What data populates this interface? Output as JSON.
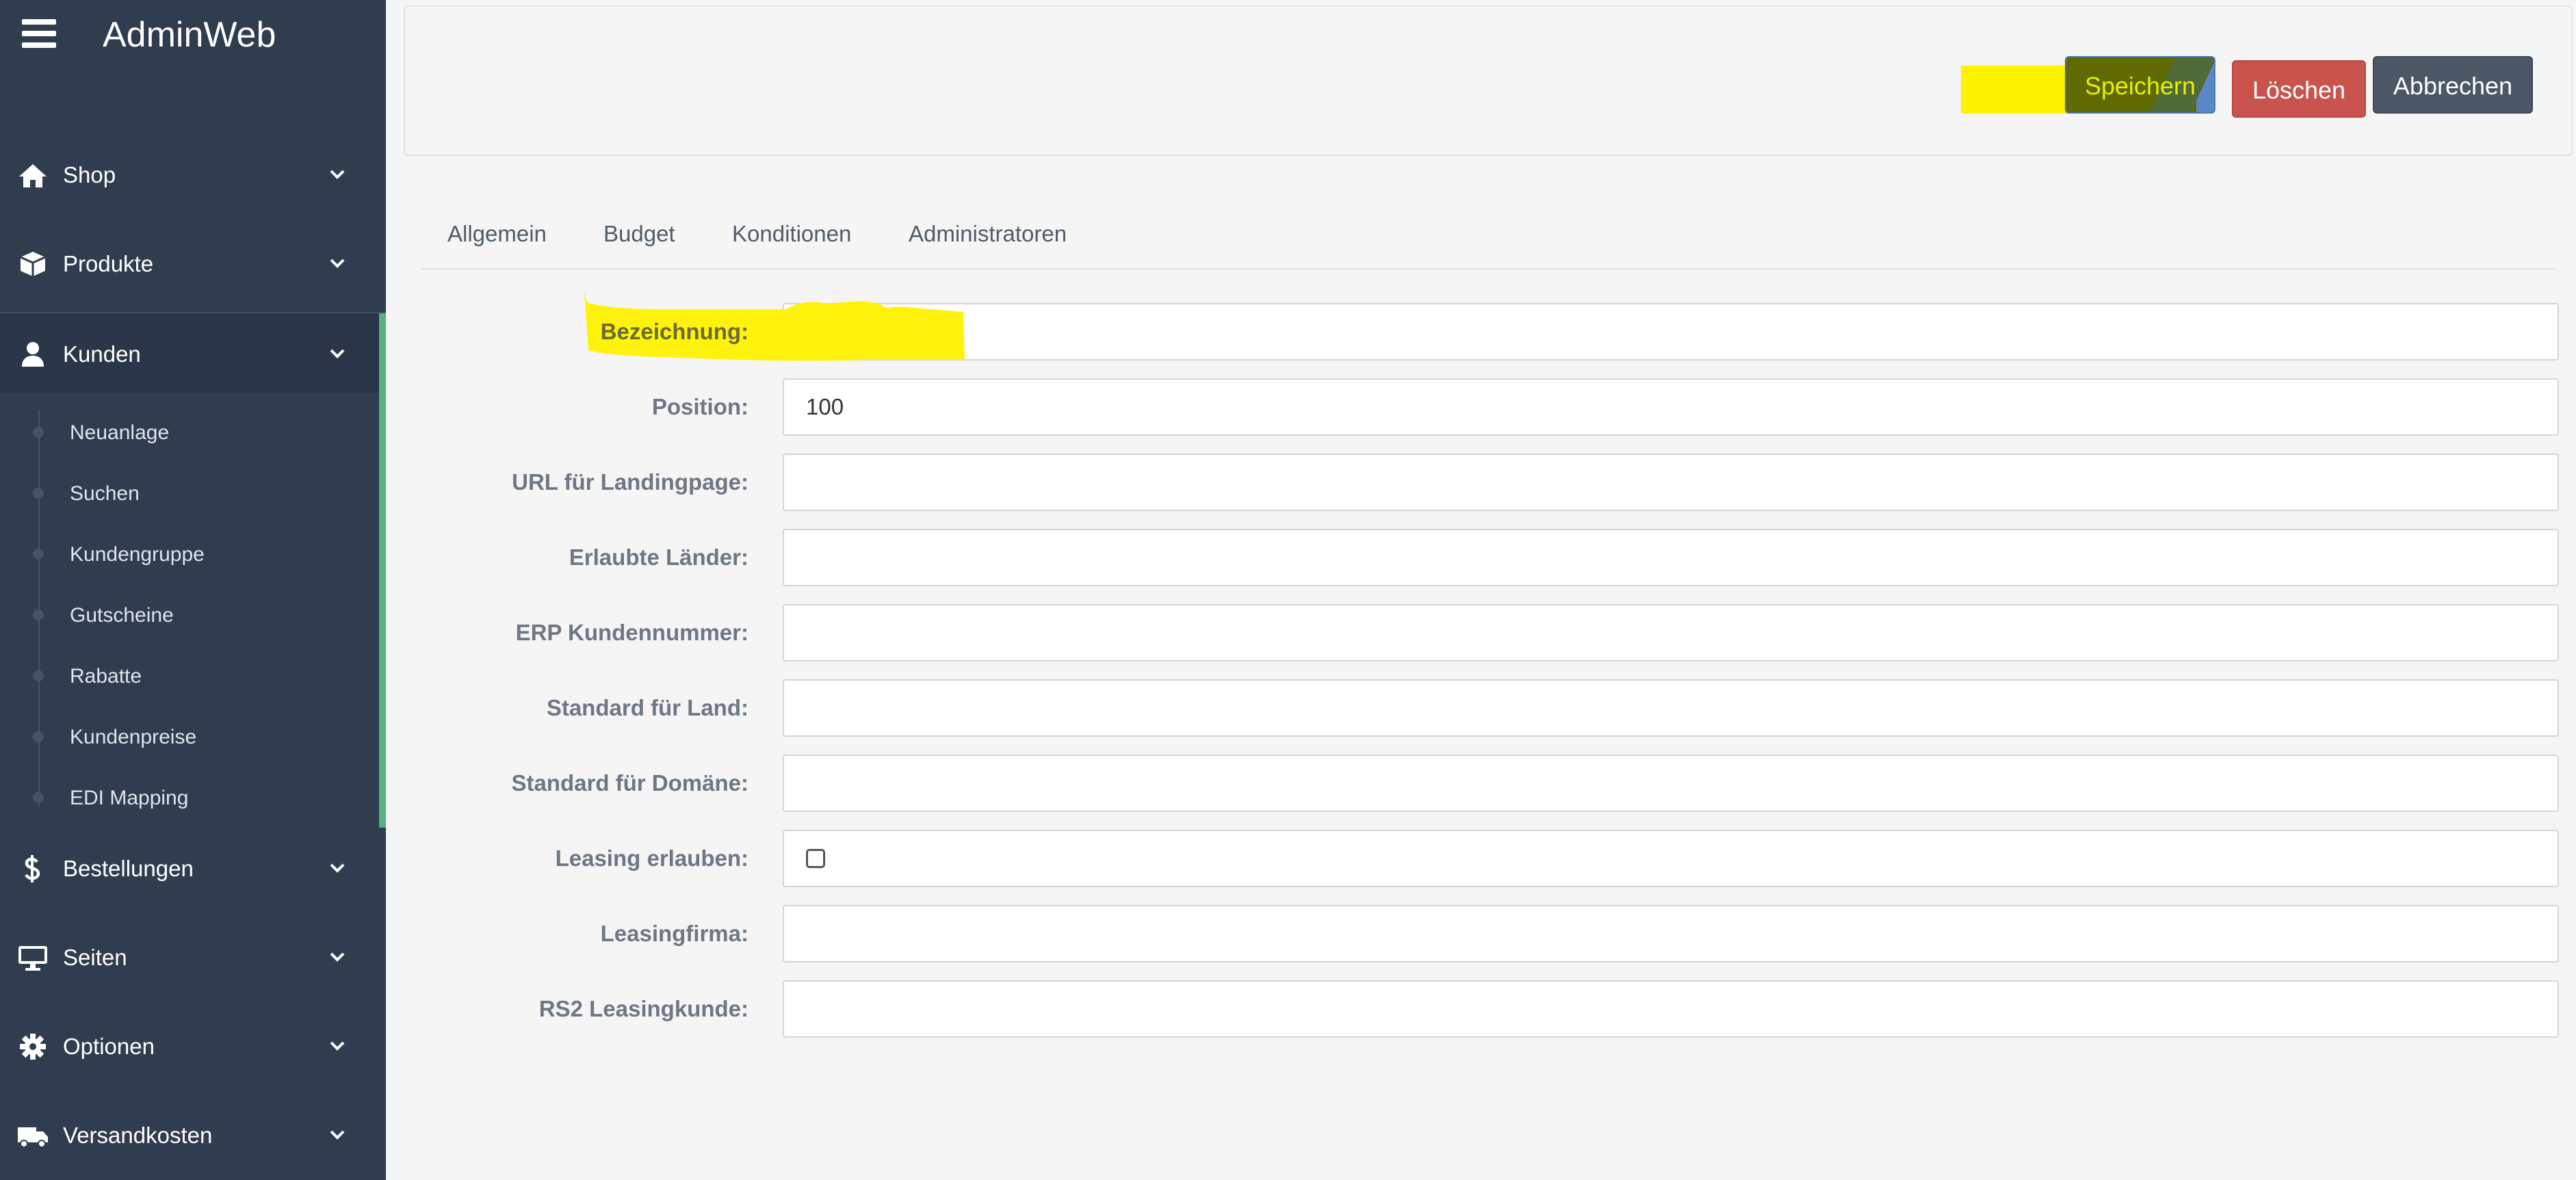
{
  "app": {
    "title": "AdminWeb"
  },
  "sidebar": {
    "items": [
      {
        "label": "Shop",
        "icon": "home-icon"
      },
      {
        "label": "Produkte",
        "icon": "box-icon"
      },
      {
        "label": "Kunden",
        "icon": "user-icon"
      },
      {
        "label": "Bestellungen",
        "icon": "dollar-icon"
      },
      {
        "label": "Seiten",
        "icon": "monitor-icon"
      },
      {
        "label": "Optionen",
        "icon": "gear-icon"
      },
      {
        "label": "Versandkosten",
        "icon": "truck-icon"
      }
    ],
    "sub_items": [
      "Neuanlage",
      "Suchen",
      "Kundengruppe",
      "Gutscheine",
      "Rabatte",
      "Kundenpreise",
      "EDI Mapping"
    ]
  },
  "toolbar": {
    "save_label": "Speichern",
    "delete_label": "Löschen",
    "cancel_label": "Abbrechen"
  },
  "tabs": [
    "Allgemein",
    "Budget",
    "Konditionen",
    "Administratoren"
  ],
  "form": {
    "fields": [
      {
        "label": "Bezeichnung:",
        "value": ""
      },
      {
        "label": "Position:",
        "value": "100"
      },
      {
        "label": "URL für Landingpage:",
        "value": ""
      },
      {
        "label": "Erlaubte Länder:",
        "value": ""
      },
      {
        "label": "ERP Kundennummer:",
        "value": ""
      },
      {
        "label": "Standard für Land:",
        "value": ""
      },
      {
        "label": "Standard für Domäne:",
        "value": ""
      },
      {
        "label": "Leasing erlauben:",
        "checked": false
      },
      {
        "label": "Leasingfirma:",
        "value": ""
      },
      {
        "label": "RS2 Leasingkunde:",
        "value": ""
      }
    ]
  },
  "colors": {
    "sidebar_bg": "#2f3d4f",
    "accent_green": "#5ab07e",
    "save_blue": "#5b87c7",
    "delete_red": "#c9544e",
    "cancel_gray": "#4b5765",
    "highlight_yellow": "#fff200"
  }
}
